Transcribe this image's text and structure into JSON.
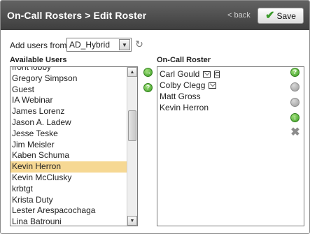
{
  "header": {
    "title": "On-Call Rosters > Edit Roster",
    "back_label": "< back",
    "save_label": "Save"
  },
  "add_users": {
    "label": "Add users from",
    "selected_source": "AD_Hybrid"
  },
  "available_users": {
    "heading": "Available Users",
    "items": [
      "front lobby",
      "Gregory Simpson",
      "Guest",
      "IA Webinar",
      "James Lorenz",
      "Jason A. Ladew",
      "Jesse Teske",
      "Jim Meisler",
      "Kaben Schuma",
      "Kevin Herron",
      "Kevin McClusky",
      "krbtgt",
      "Krista Duty",
      "Lester Arespacochaga",
      "Lina Batrouni"
    ],
    "selected": "Kevin Herron"
  },
  "on_call_roster": {
    "heading": "On-Call Roster",
    "items": [
      {
        "name": "Carl Gould",
        "icons": [
          "envelope-icon",
          "phone-icon"
        ]
      },
      {
        "name": "Colby Clegg",
        "icons": [
          "envelope-icon"
        ]
      },
      {
        "name": "Matt Gross",
        "icons": []
      },
      {
        "name": "Kevin Herron",
        "icons": []
      }
    ]
  },
  "colors": {
    "header_bg": "#4a4a4a",
    "selection": "#f6d893",
    "green_action": "#3d9e24",
    "disabled_action": "#9c9c9c"
  }
}
